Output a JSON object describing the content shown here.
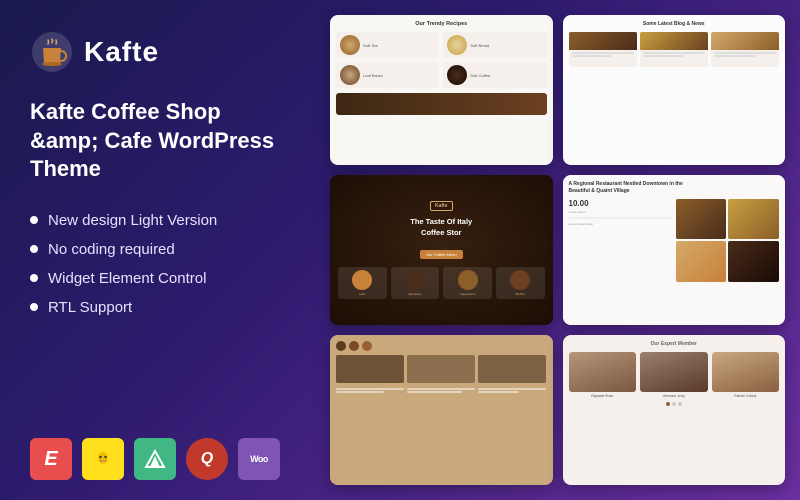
{
  "logo": {
    "text": "Kafte",
    "icon_name": "coffee-cup-icon"
  },
  "theme": {
    "title": "Kafte Coffee Shop &amp; Cafe WordPress Theme"
  },
  "features": [
    {
      "text": "New design Light Version"
    },
    {
      "text": "No coding required"
    },
    {
      "text": "Widget Element Control"
    },
    {
      "text": "RTL Support"
    }
  ],
  "plugins": [
    {
      "name": "Elementor",
      "label": "E",
      "class": "plugin-elementor",
      "aria": "elementor-icon"
    },
    {
      "name": "Mailchimp",
      "label": "✉",
      "class": "plugin-mailchimp",
      "aria": "mailchimp-icon"
    },
    {
      "name": "Vuejs",
      "label": "▲",
      "class": "plugin-vuejs",
      "aria": "vuejs-icon"
    },
    {
      "name": "Query",
      "label": "Q",
      "class": "plugin-query",
      "aria": "query-icon"
    },
    {
      "name": "WooCommerce",
      "label": "Woo",
      "class": "plugin-woo",
      "aria": "woocommerce-icon"
    }
  ],
  "screenshots": {
    "sc1": {
      "title": "Our Trendy Recipes",
      "items": [
        "Soft Tea",
        "Soft Bread",
        "Loaf Bread",
        "Soft Coffee"
      ]
    },
    "sc2": {
      "title": "Some Latest Blog & News"
    },
    "sc3": {
      "logo": "Kafte",
      "hero_line1": "The Taste Of Italy",
      "hero_line2": "Coffee Stor"
    },
    "sc4": {
      "headline": "A Regional Restaurant Nestled Downtown in the Beautiful & Quaint Village",
      "price": "10.00"
    },
    "sc5": {},
    "sc6": {
      "title": "Our Expert Member",
      "members": [
        "Raphael Khan",
        "Veronica Jerry",
        "Patrick Collins"
      ]
    }
  },
  "colors": {
    "background_start": "#1a1a4e",
    "background_end": "#6b2fa0",
    "accent": "#d4a96a",
    "white": "#ffffff"
  }
}
